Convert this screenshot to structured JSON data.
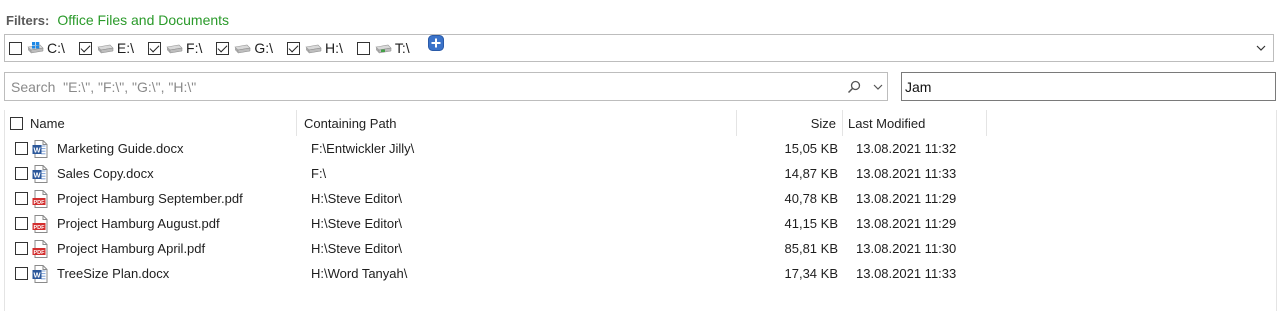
{
  "filters": {
    "label": "Filters:",
    "value": "Office Files and Documents",
    "value_color": "#2a9a2a"
  },
  "drives": [
    {
      "label": "C:\\",
      "checked": false,
      "icon": "windows-drive-icon"
    },
    {
      "label": "E:\\",
      "checked": true,
      "icon": "hard-drive-icon"
    },
    {
      "label": "F:\\",
      "checked": true,
      "icon": "hard-drive-icon"
    },
    {
      "label": "G:\\",
      "checked": true,
      "icon": "hard-drive-icon"
    },
    {
      "label": "H:\\",
      "checked": true,
      "icon": "hard-drive-icon"
    },
    {
      "label": "T:\\",
      "checked": false,
      "icon": "network-drive-icon"
    }
  ],
  "search": {
    "placeholder": "Search  \"E:\\\", \"F:\\\", \"G:\\\", \"H:\\\"",
    "term": "Jam"
  },
  "table": {
    "columns": {
      "name": "Name",
      "path": "Containing Path",
      "size": "Size",
      "modified": "Last Modified"
    },
    "rows": [
      {
        "name": "Marketing Guide.docx",
        "path": "F:\\Entwickler Jilly\\",
        "size": "15,05 KB",
        "modified": "13.08.2021 11:32",
        "type": "word"
      },
      {
        "name": "Sales Copy.docx",
        "path": "F:\\",
        "size": "14,87 KB",
        "modified": "13.08.2021 11:33",
        "type": "word"
      },
      {
        "name": "Project Hamburg September.pdf",
        "path": "H:\\Steve Editor\\",
        "size": "40,78 KB",
        "modified": "13.08.2021 11:29",
        "type": "pdf"
      },
      {
        "name": "Project Hamburg August.pdf",
        "path": "H:\\Steve Editor\\",
        "size": "41,15 KB",
        "modified": "13.08.2021 11:29",
        "type": "pdf"
      },
      {
        "name": "Project Hamburg April.pdf",
        "path": "H:\\Steve Editor\\",
        "size": "85,81 KB",
        "modified": "13.08.2021 11:30",
        "type": "pdf"
      },
      {
        "name": "TreeSize Plan.docx",
        "path": "H:\\Word Tanyah\\",
        "size": "17,34 KB",
        "modified": "13.08.2021 11:33",
        "type": "word"
      }
    ]
  },
  "colors": {
    "word": "#2b579a",
    "pdf": "#d32f2f",
    "add": "#3b73c9",
    "windows": "#1e88e5",
    "network": "#43a047"
  }
}
